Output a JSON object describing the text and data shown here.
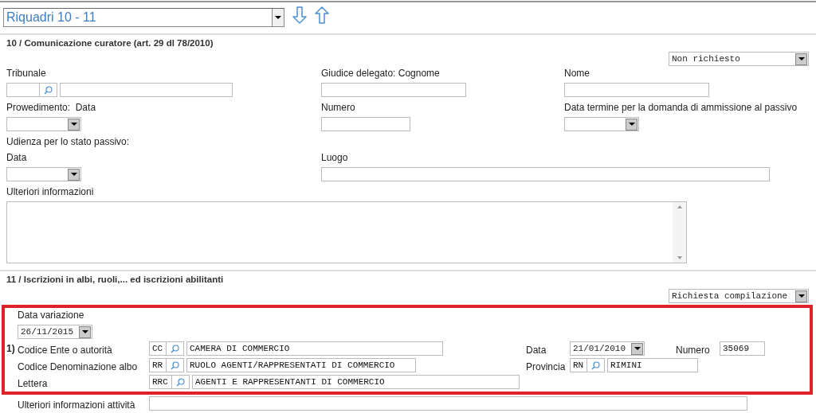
{
  "navigator": {
    "value": "Riquadri 10 - 11"
  },
  "section10": {
    "number": "10",
    "title": "/ Comunicazione curatore (art. 29 dl 78/2010)",
    "status": "Non richiesto",
    "rows": [
      {
        "columns": [
          {
            "label": "Tribunale",
            "field": {
              "kind": "lookup"
            }
          },
          {
            "label": "Giudice delegato: Cognome",
            "field": {
              "kind": "text"
            }
          },
          {
            "label": "Nome",
            "field": {
              "kind": "text"
            }
          }
        ]
      },
      {
        "columns": [
          {
            "label": "Prowedimento:  Data",
            "field": {
              "kind": "date"
            }
          },
          {
            "label": "Numero",
            "field": {
              "kind": "text"
            }
          },
          {
            "label": "Data termine per la domanda di ammissione al passivo",
            "field": {
              "kind": "date"
            }
          }
        ]
      },
      {
        "columns": [
          {
            "label": "Udienza per lo stato passivo:"
          }
        ]
      },
      {
        "columns": [
          {
            "label": "Data",
            "field": {
              "kind": "date"
            }
          },
          {
            "label": "Luogo",
            "field": {
              "kind": "text"
            }
          }
        ]
      },
      {
        "columns": [
          {
            "label": "Ulteriori informazioni",
            "field": {
              "kind": "textarea"
            }
          }
        ]
      }
    ]
  },
  "section11": {
    "number": "11",
    "title": "/ Iscrizioni in albi, ruoli,... ed iscrizioni abilitanti",
    "status": "Richiesta compilazione",
    "highlighted": true,
    "data_variazione": {
      "label": "Data variazione",
      "value": "26/11/2015"
    },
    "entry": {
      "index": "1)",
      "rows": [
        {
          "label": "Codice Ente o autorità",
          "code": "CC",
          "description": "CAMERA DI COMMERCIO",
          "side": [
            {
              "kind": "date",
              "label": "Data",
              "value": "21/01/2010"
            },
            {
              "kind": "text",
              "label": "Numero",
              "value": "35069"
            }
          ]
        },
        {
          "label": "Codice Denominazione albo",
          "code": "RR",
          "description": "RUOLO AGENTI/RAPPRESENTATI DI COMMERCIO",
          "side": [
            {
              "kind": "lookup",
              "label": "Provincia",
              "code": "RN",
              "description": "RIMINI"
            }
          ]
        },
        {
          "label": "Lettera",
          "code": "RRC",
          "description": "AGENTI E RAPPRESENTANTI DI COMMERCIO"
        }
      ]
    },
    "extra": {
      "label": "Ulteriori informazioni attività"
    }
  }
}
